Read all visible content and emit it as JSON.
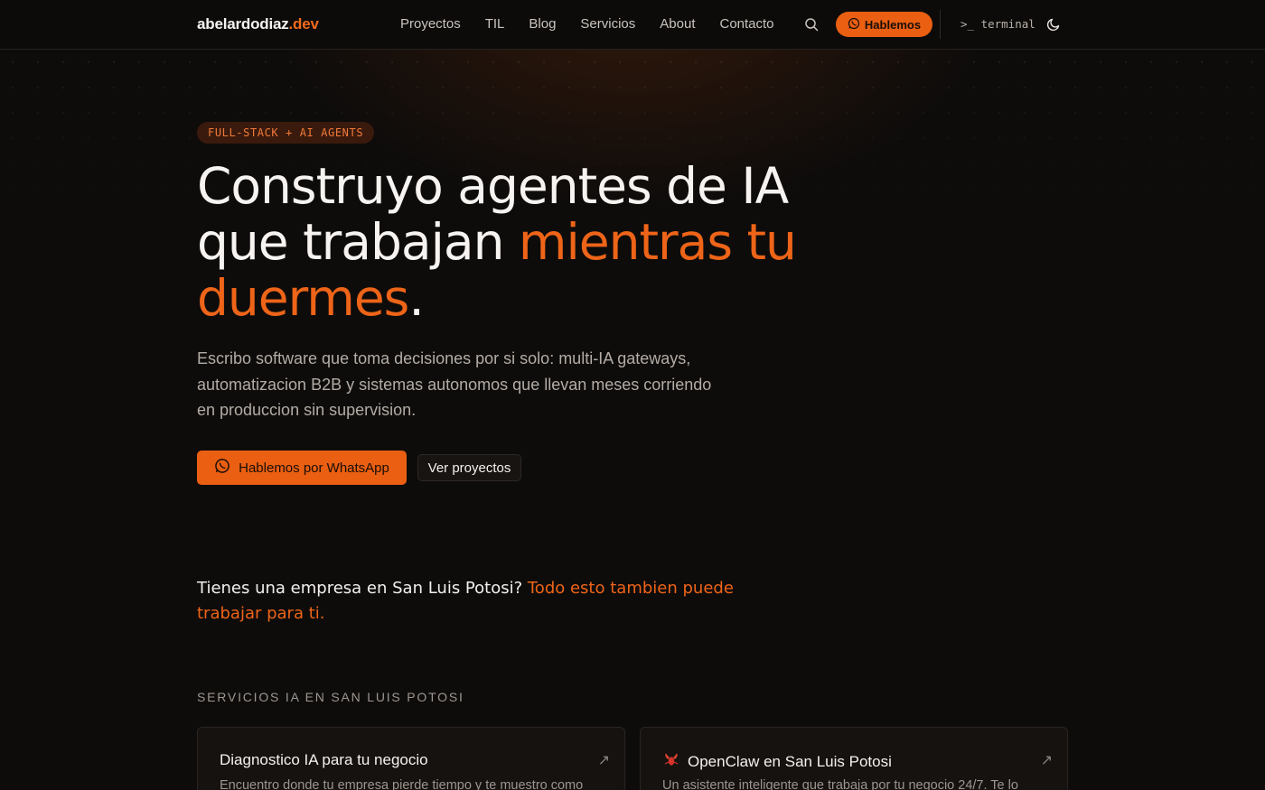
{
  "nav": {
    "brand_main": "abelardodiaz",
    "brand_accent": ".dev",
    "links": [
      "Proyectos",
      "TIL",
      "Blog",
      "Servicios",
      "About",
      "Contacto"
    ],
    "cta_label": "Hablemos",
    "terminal_label": ">_ terminal",
    "search_icon": "search-icon",
    "theme_icon": "moon-icon"
  },
  "hero": {
    "badge": "FULL-STACK + AI AGENTS",
    "title_part1": "Construyo agentes de IA que trabajan ",
    "title_highlight": "mientras tu duermes",
    "title_end": ".",
    "lead": "Escribo software que toma decisiones por si solo: multi-IA gateways, automatizacion B2B y sistemas autonomos que llevan meses corriendo en produccion sin supervision.",
    "primary_button": "Hablemos por WhatsApp",
    "secondary_button": "Ver proyectos"
  },
  "local": {
    "question": "Tienes una empresa en San Luis Potosi? ",
    "highlight": "Todo esto tambien puede trabajar para ti."
  },
  "services": {
    "section_title": "SERVICIOS IA EN SAN LUIS POTOSI",
    "cards": [
      {
        "title": "Diagnostico IA para tu negocio",
        "description": "Encuentro donde tu empresa pierde tiempo y te muestro como",
        "arrow": "↗"
      },
      {
        "icon": "lobster-icon",
        "title": "OpenClaw en San Luis Potosi",
        "description": "Un asistente inteligente que trabaja por tu negocio 24/7. Te lo",
        "arrow": "↗"
      }
    ]
  },
  "colors": {
    "accent": "#ea5f12",
    "background": "#0e0c0b",
    "text": "#f2efec"
  }
}
